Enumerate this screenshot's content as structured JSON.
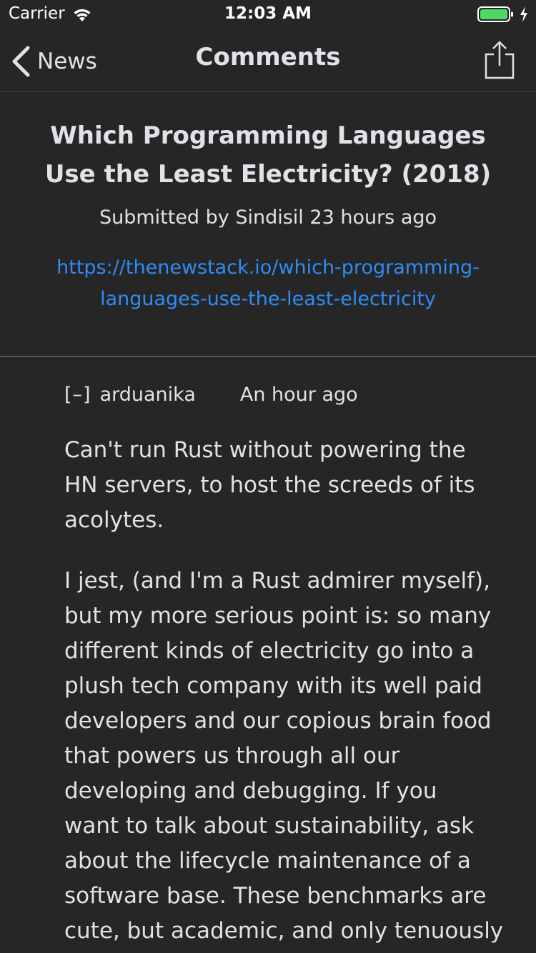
{
  "status_bar": {
    "carrier": "Carrier",
    "time": "12:03 AM",
    "battery_color": "#4cd964"
  },
  "nav": {
    "back_label": "News",
    "title": "Comments"
  },
  "story": {
    "title": "Which Programming Languages Use the Least Electricity? (2018)",
    "meta": "Submitted by Sindisil 23 hours ago",
    "link_line1": "https://thenewstack.io/which-programming-",
    "link_line2": "languages-use-the-least-electricity",
    "link_color": "#2f8cf5"
  },
  "comment": {
    "collapse": "[–]",
    "author": "arduanika",
    "time": "An hour ago",
    "paragraph1_lines": [
      "Can't run Rust without powering the",
      "HN servers, to host the screeds of its",
      "acolytes."
    ],
    "paragraph2_lines": [
      "I jest, (and I'm a Rust admirer myself),",
      "but my more serious point is: so many",
      "different kinds of electricity go into a",
      "plush tech company with its well paid",
      "developers and our copious brain food",
      "that powers us through all our",
      "developing and debugging. If you",
      "want to talk about sustainability, ask",
      "about the lifecycle maintenance of a",
      "software base. These benchmarks are",
      "cute, but academic, and only tenuously"
    ]
  }
}
